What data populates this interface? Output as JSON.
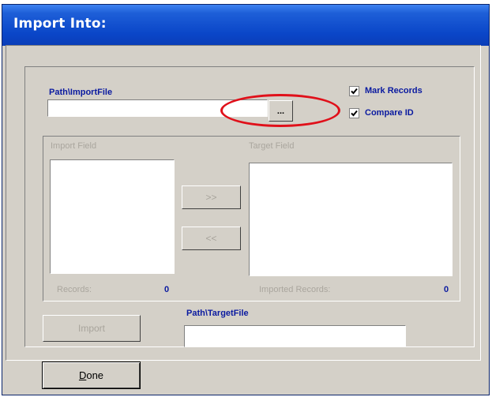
{
  "window": {
    "title": "Import Into:"
  },
  "import_file": {
    "label": "Path\\ImportFile",
    "value": "",
    "browse_label": "..."
  },
  "options": {
    "mark_records": {
      "label": "Mark Records",
      "checked": true
    },
    "compare_id": {
      "label": "Compare ID",
      "checked": true
    }
  },
  "fields": {
    "import_field_label": "Import Field",
    "target_field_label": "Target Field",
    "add_label": ">>",
    "remove_label": "<<",
    "records_label": "Records:",
    "records_count": "0",
    "imported_records_label": "Imported Records:",
    "imported_records_count": "0"
  },
  "import_button_label": "Import",
  "target_file": {
    "label": "Path\\TargetFile",
    "value": ""
  },
  "done": {
    "mnemonic": "D",
    "rest": "one"
  },
  "colors": {
    "label_blue": "#0a1aa0",
    "annotation_red": "#e0101a",
    "title_blue": "#0a46c8"
  }
}
